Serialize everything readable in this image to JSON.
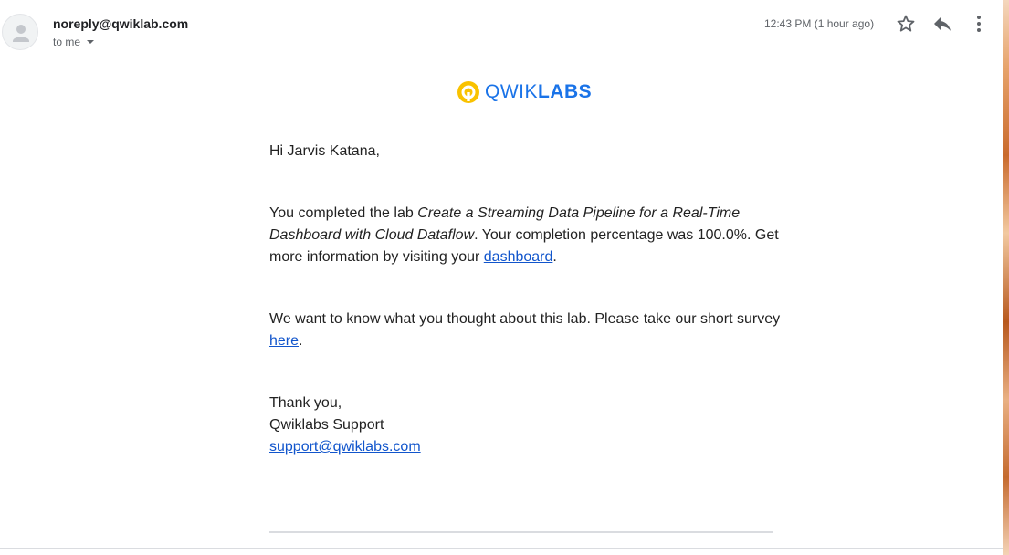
{
  "email": {
    "sender": "noreply@qwiklab.com",
    "recipient": "to me",
    "timestamp": "12:43 PM (1 hour ago)",
    "icons": {
      "avatar": "person-avatar-icon",
      "caret": "chevron-down-icon",
      "star": "star-icon",
      "reply": "reply-icon",
      "more": "more-vert-icon"
    }
  },
  "logo": {
    "part1": "QWIK",
    "part2": "LABS",
    "mark_color": "#f9c200",
    "text_color": "#1a73e8"
  },
  "message": {
    "greeting": "Hi Jarvis Katana,",
    "completion_prefix": "You completed the lab ",
    "lab_name": "Create a Streaming Data Pipeline for a Real-Time Dashboard with Cloud Dataflow",
    "completion_middle": ". Your completion percentage was 100.0%. Get more information by visiting your ",
    "dashboard_link": "dashboard",
    "completion_end": ".",
    "survey_prefix": "We want to know what you thought about this lab. Please take our short survey ",
    "survey_link": "here",
    "survey_end": ".",
    "thanks": "Thank you,",
    "team": "Qwiklabs Support",
    "support_email": "support@qwiklabs.com"
  },
  "colors": {
    "link": "#1155cc",
    "text": "#222222",
    "muted": "#5f6368"
  }
}
